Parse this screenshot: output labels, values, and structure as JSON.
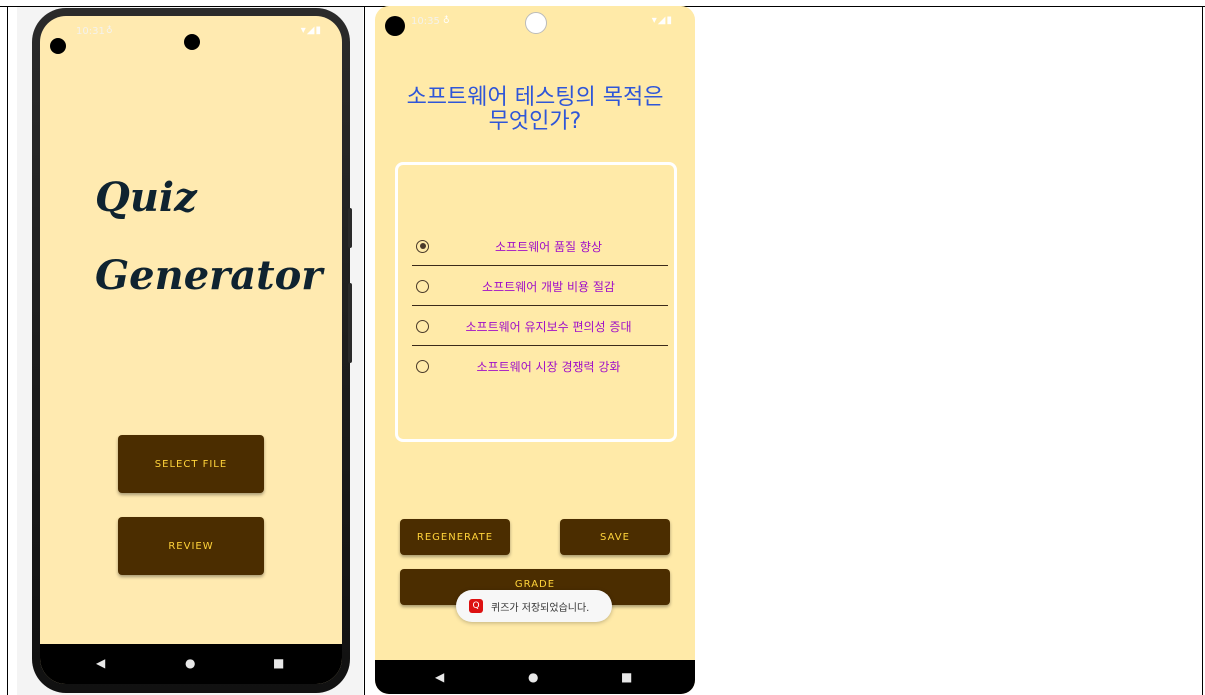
{
  "left_screen": {
    "status_time": "10:31",
    "status_extra": "♁",
    "status_icons": "▾◢▮",
    "title_line1": "Quiz",
    "title_line2": "Generator",
    "select_file_label": "SELECT FILE",
    "review_label": "REVIEW",
    "nav_back": "◀",
    "nav_home": "●",
    "nav_recent": "■"
  },
  "right_screen": {
    "status_time": "10:35",
    "status_extra": "♁",
    "status_icons": "▾◢▮",
    "question": "소프트웨어 테스팅의 목적은 무엇인가?",
    "options": [
      {
        "label": "소프트웨어 품질 향상",
        "selected": true
      },
      {
        "label": "소프트웨어 개발 비용 절감",
        "selected": false
      },
      {
        "label": "소프트웨어 유지보수 편의성 증대",
        "selected": false
      },
      {
        "label": "소프트웨어 시장 경쟁력 강화",
        "selected": false
      }
    ],
    "regenerate_label": "REGENERATE",
    "save_label": "SAVE",
    "grade_label": "GRADE",
    "toast_icon": "Q",
    "toast_text": "퀴즈가 저장되었습니다.",
    "nav_back": "◀",
    "nav_home": "●",
    "nav_recent": "■"
  },
  "colors": {
    "screen_bg": "#ffeab0",
    "button_bg": "#4b2d00",
    "button_text": "#ffd33a",
    "question_text": "#2f56d8",
    "option_text": "#a010c8",
    "title_text": "#0f2330"
  }
}
